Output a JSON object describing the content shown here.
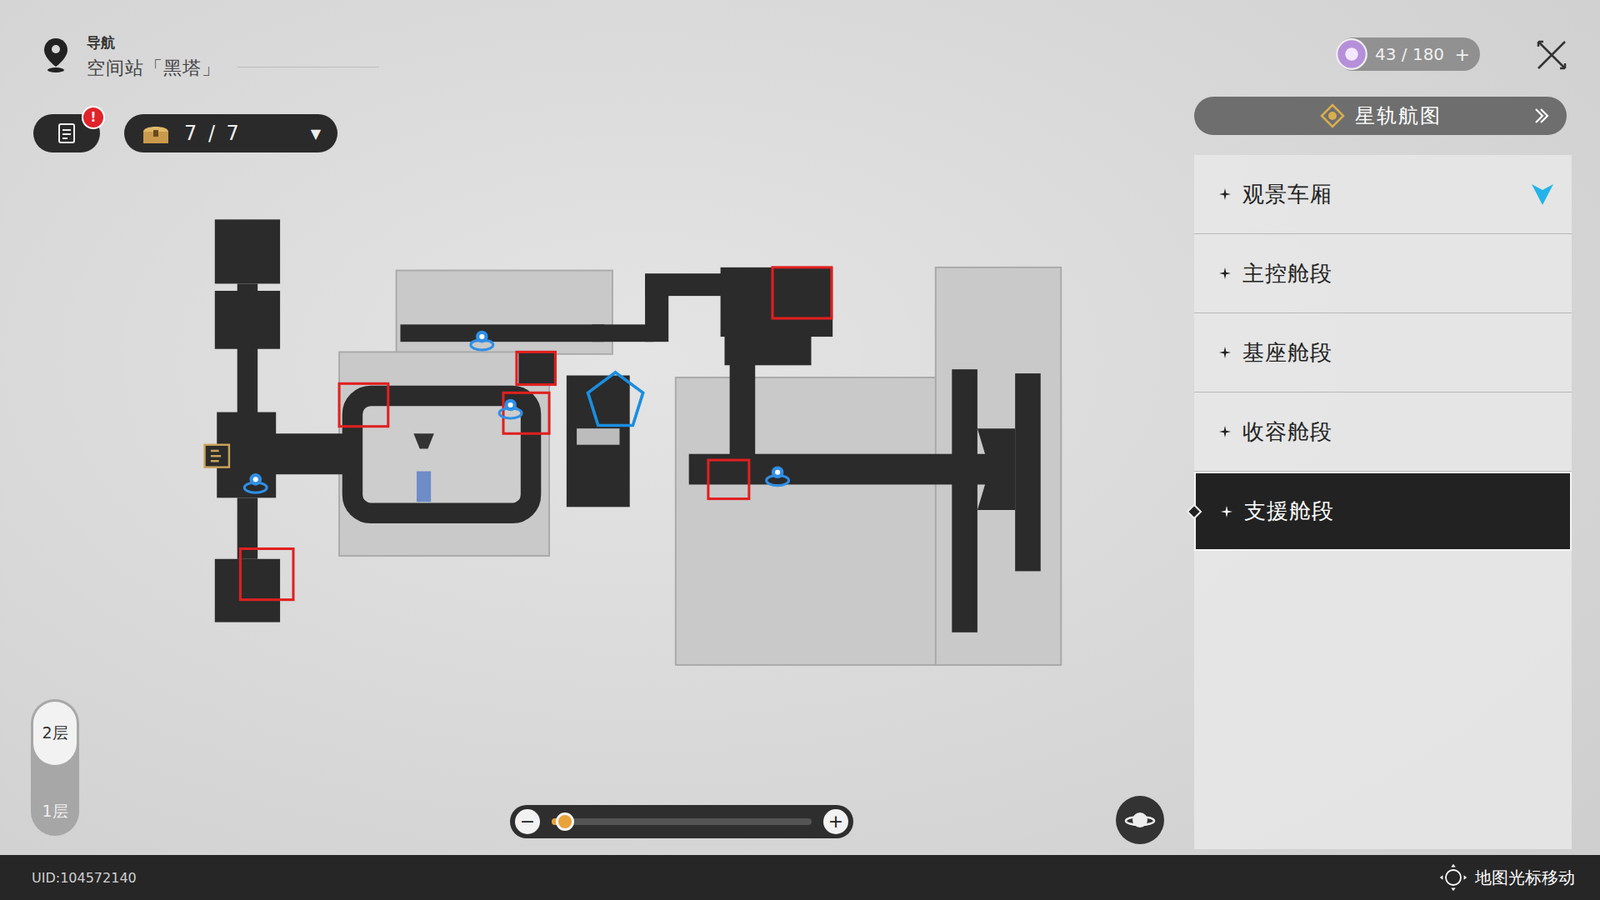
{
  "navigation": {
    "label": "导航",
    "location": "空间站「黑塔」"
  },
  "quest_badge": "!",
  "chest": {
    "count": "7 / 7",
    "arrow": "▼"
  },
  "currency": {
    "value": "43 / 180",
    "add": "+"
  },
  "star_rail_map_button": "星轨航图",
  "regions": [
    {
      "name": "观景车厢",
      "selected": false,
      "current": true
    },
    {
      "name": "主控舱段",
      "selected": false,
      "current": false
    },
    {
      "name": "基座舱段",
      "selected": false,
      "current": false
    },
    {
      "name": "收容舱段",
      "selected": false,
      "current": false
    },
    {
      "name": "支援舱段",
      "selected": true,
      "current": false
    }
  ],
  "floors": [
    {
      "label": "2层",
      "selected": true
    },
    {
      "label": "1层",
      "selected": false
    }
  ],
  "zoom": {
    "level": 0.03,
    "minus": "−",
    "plus": "+"
  },
  "uid": "UID:104572140",
  "hint": "地图光标移动"
}
